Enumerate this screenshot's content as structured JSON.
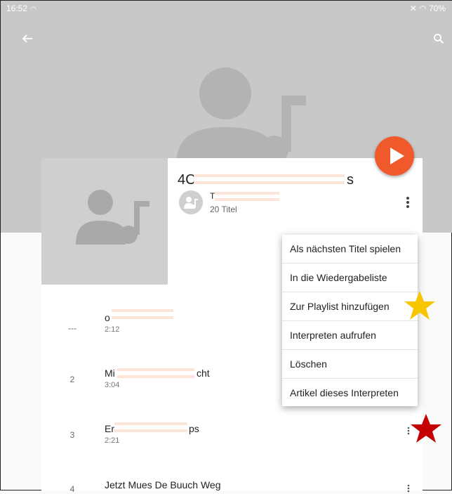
{
  "status_bar": {
    "time": "16:52",
    "battery": "70%"
  },
  "toolbar": {
    "back_icon": "arrow-left-icon",
    "search_icon": "search-icon"
  },
  "album": {
    "title_start": "4C",
    "title_end": "s",
    "artist_start": "T",
    "track_count": "20 Titel"
  },
  "tracks": [
    {
      "number": "---",
      "title_start": "o",
      "title_end": "",
      "duration": "2:12"
    },
    {
      "number": "2",
      "title_start": "Mi",
      "title_end": "cht",
      "duration": "3:04"
    },
    {
      "number": "3",
      "title_start": "Er",
      "title_end": "ps",
      "duration": "2:21"
    },
    {
      "number": "4",
      "title_start": "Jetzt Mues De Buuch Weg",
      "title_end": "",
      "duration": ""
    }
  ],
  "context_menu": {
    "items": [
      "Als nächsten Titel spielen",
      "In die Wiedergabeliste",
      "Zur Playlist hinzufügen",
      "Interpreten aufrufen",
      "Löschen",
      "Artikel dieses Interpreten"
    ]
  },
  "annotations": {
    "gold_star_color": "#f7c600",
    "red_star_color": "#c40000"
  },
  "colors": {
    "accent": "#f05a2a",
    "header": "#c8c8c8"
  }
}
